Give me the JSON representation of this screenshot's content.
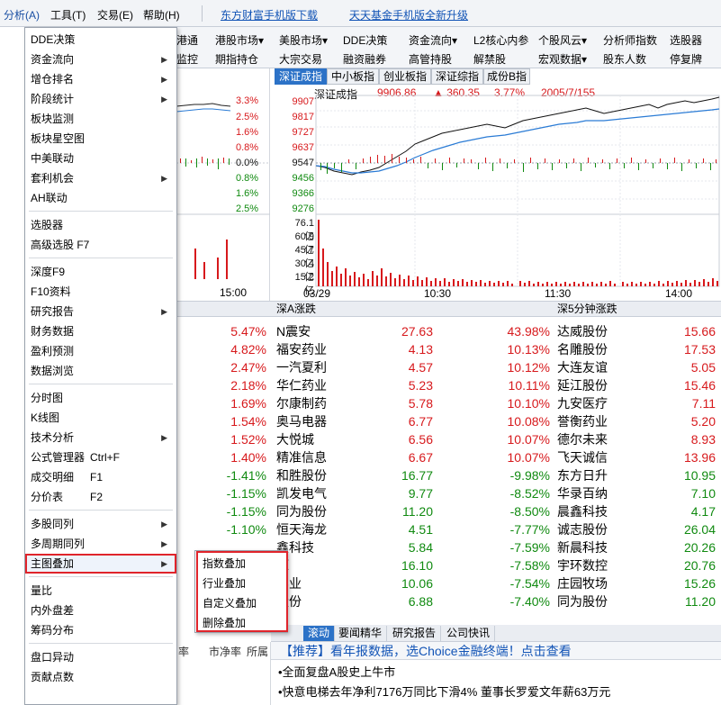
{
  "menubar": {
    "items": [
      "分析(A)",
      "工具(T)",
      "交易(E)",
      "帮助(H)"
    ],
    "links": [
      "东方财富手机版下载",
      "天天基金手机版全新升级"
    ]
  },
  "toolbar": {
    "row1": [
      "港股市场▾",
      "美股市场▾",
      "DDE决策",
      "资金流向▾",
      "L2核心内参",
      "个股风云▾",
      "分析师指数",
      "选股器"
    ],
    "row2": [
      "期指持仓",
      "大宗交易",
      "融资融券",
      "高管持股",
      "解禁股",
      "宏观数据▾",
      "股东人数",
      "停复牌"
    ],
    "left_fragments": [
      "港通",
      "监控"
    ]
  },
  "left_chart": {
    "percents": [
      "3.3%",
      "2.5%",
      "1.6%",
      "0.8%",
      "0.0%",
      "0.8%",
      "1.6%",
      "2.5%"
    ],
    "time": "15:00"
  },
  "right_chart": {
    "tabs": [
      "深证成指",
      "中小板指",
      "创业板指",
      "深证综指",
      "成份B指"
    ],
    "index_name": "深证成指",
    "index_value": "9906.86",
    "change": "▲ 360.35",
    "change_pct": "3.77%",
    "counts": "2005/7/155",
    "price_ticks": [
      "9907",
      "9817",
      "9727",
      "9637",
      "9547",
      "9456",
      "9366",
      "9276"
    ],
    "vol_ticks": [
      "76.1亿",
      "60.9亿",
      "45.7亿",
      "30.4亿",
      "15.2亿"
    ],
    "times": [
      "03/29",
      "10:30",
      "11:30",
      "14:00"
    ]
  },
  "tables": {
    "hdr_a": "深A涨跌",
    "hdr_5min": "深5分钟涨跌",
    "left_pcts": [
      "5.47%",
      "4.82%",
      "2.47%",
      "2.18%",
      "1.69%",
      "1.54%",
      "1.52%",
      "1.40%",
      "-1.41%",
      "-1.15%",
      "-1.15%",
      "-1.10%"
    ],
    "a_rows": [
      {
        "name": "N震安",
        "price": "27.63",
        "pct": "43.98%"
      },
      {
        "name": "福安药业",
        "price": "4.13",
        "pct": "10.13%"
      },
      {
        "name": "一汽夏利",
        "price": "4.57",
        "pct": "10.12%"
      },
      {
        "name": "华仁药业",
        "price": "5.23",
        "pct": "10.11%"
      },
      {
        "name": "尔康制药",
        "price": "5.78",
        "pct": "10.10%"
      },
      {
        "name": "奥马电器",
        "price": "6.77",
        "pct": "10.08%"
      },
      {
        "name": "大悦城",
        "price": "6.56",
        "pct": "10.07%"
      },
      {
        "name": "精准信息",
        "price": "6.67",
        "pct": "10.07%"
      },
      {
        "name": "和胜股份",
        "price": "16.77",
        "pct": "-9.98%"
      },
      {
        "name": "凯发电气",
        "price": "9.77",
        "pct": "-8.52%"
      },
      {
        "name": "同为股份",
        "price": "11.20",
        "pct": "-8.50%"
      },
      {
        "name": "恒天海龙",
        "price": "4.51",
        "pct": "-7.77%"
      },
      {
        "name": "鑫科技",
        "price": "5.84",
        "pct": "-7.59%"
      },
      {
        "name": "源",
        "price": "16.10",
        "pct": "-7.58%"
      },
      {
        "name": "实业",
        "price": "10.06",
        "pct": "-7.54%"
      },
      {
        "name": "股份",
        "price": "6.88",
        "pct": "-7.40%"
      }
    ],
    "m5_rows": [
      {
        "name": "达威股份",
        "price": "15.66"
      },
      {
        "name": "名雕股份",
        "price": "17.53"
      },
      {
        "name": "大连友谊",
        "price": "5.05"
      },
      {
        "name": "延江股份",
        "price": "15.46"
      },
      {
        "name": "九安医疗",
        "price": "7.11"
      },
      {
        "name": "誉衡药业",
        "price": "5.20"
      },
      {
        "name": "德尔未来",
        "price": "8.93"
      },
      {
        "name": "飞天诚信",
        "price": "13.96"
      },
      {
        "name": "东方日升",
        "price": "10.95"
      },
      {
        "name": "华录百纳",
        "price": "7.10"
      },
      {
        "name": "晨鑫科技",
        "price": "4.17"
      },
      {
        "name": "诚志股份",
        "price": "26.04"
      },
      {
        "name": "新晨科技",
        "price": "20.26"
      },
      {
        "name": "宇环数控",
        "price": "20.76"
      },
      {
        "name": "庄园牧场",
        "price": "15.26"
      },
      {
        "name": "同为股份",
        "price": "11.20"
      }
    ]
  },
  "bottom": {
    "news_tabs": [
      "滚动",
      "要闻精华",
      "研究报告",
      "公司快讯"
    ],
    "promo": "【推荐】看年报数据，选Choice金融终端！点击查看",
    "news": [
      "•全面复盘A股史上牛市",
      "•快意电梯去年净利7176万同比下滑4% 董事长罗爱文年薪63万元"
    ],
    "left_cols": [
      "率",
      "市净率",
      "所属"
    ]
  },
  "menu": {
    "items": [
      {
        "label": "DDE决策",
        "arrow": false
      },
      {
        "label": "资金流向",
        "arrow": true
      },
      {
        "label": "增仓排名",
        "arrow": true
      },
      {
        "label": "阶段统计",
        "arrow": true
      },
      {
        "label": "板块监测",
        "arrow": false
      },
      {
        "label": "板块星空图",
        "arrow": false
      },
      {
        "label": "中美联动",
        "arrow": false
      },
      {
        "label": "套利机会",
        "arrow": true
      },
      {
        "label": "AH联动",
        "arrow": false
      },
      {
        "label": "选股器",
        "arrow": false
      },
      {
        "label": "高级选股 F7",
        "arrow": false
      },
      {
        "label": "深度F9",
        "arrow": false
      },
      {
        "label": "F10资料",
        "arrow": false
      },
      {
        "label": "研究报告",
        "arrow": true
      },
      {
        "label": "财务数据",
        "arrow": false
      },
      {
        "label": "盈利预测",
        "arrow": false
      },
      {
        "label": "数据浏览",
        "arrow": false
      },
      {
        "label": "分时图",
        "arrow": false
      },
      {
        "label": "K线图",
        "arrow": false
      },
      {
        "label": "技术分析",
        "arrow": true
      },
      {
        "label": "公式管理器",
        "shortcut": "Ctrl+F",
        "arrow": false
      },
      {
        "label": "成交明细",
        "shortcut": "F1",
        "arrow": false
      },
      {
        "label": "分价表",
        "shortcut": "F2",
        "arrow": false
      },
      {
        "label": "多股同列",
        "arrow": true
      },
      {
        "label": "多周期同列",
        "arrow": true
      },
      {
        "label": "主图叠加",
        "arrow": true
      },
      {
        "label": "量比",
        "arrow": false
      },
      {
        "label": "内外盘差",
        "arrow": false
      },
      {
        "label": "筹码分布",
        "arrow": false
      },
      {
        "label": "盘口异动",
        "arrow": false
      },
      {
        "label": "贡献点数",
        "arrow": false
      }
    ]
  },
  "submenu": {
    "items": [
      "指数叠加",
      "行业叠加",
      "自定义叠加",
      "删除叠加"
    ]
  }
}
